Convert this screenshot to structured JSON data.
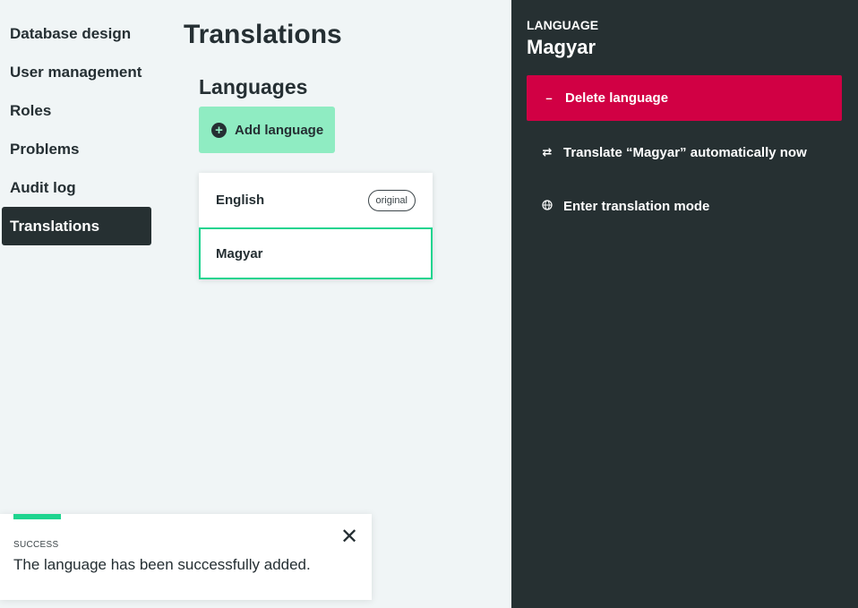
{
  "nav": {
    "items": [
      {
        "label": "Database design"
      },
      {
        "label": "User management"
      },
      {
        "label": "Roles"
      },
      {
        "label": "Problems"
      },
      {
        "label": "Audit log"
      },
      {
        "label": "Translations",
        "active": true
      }
    ]
  },
  "page": {
    "title": "Translations",
    "section_title": "Languages",
    "add_button_label": "Add language"
  },
  "languages": [
    {
      "name": "English",
      "badge": "original"
    },
    {
      "name": "Magyar",
      "badge": "",
      "selected": true
    }
  ],
  "toast": {
    "kind": "SUCCESS",
    "message": "The language has been successfully added.",
    "close_glyph": "✕"
  },
  "panel": {
    "kicker": "LANGUAGE",
    "title": "Magyar",
    "actions": {
      "delete_label": "Delete language",
      "translate_label": "Translate “Magyar” automatically now",
      "translation_mode_label": "Enter translation mode"
    }
  },
  "colors": {
    "accent_green": "#1ed48f",
    "add_button_bg": "#8fecc2",
    "dark": "#263032",
    "danger": "#d10044",
    "page_bg": "#f0f5f6"
  },
  "icons": {
    "add": "plus-circle-icon",
    "delete": "minus-icon",
    "translate": "swap-arrows-icon",
    "translation_mode": "globe-icon",
    "close": "close-icon"
  }
}
